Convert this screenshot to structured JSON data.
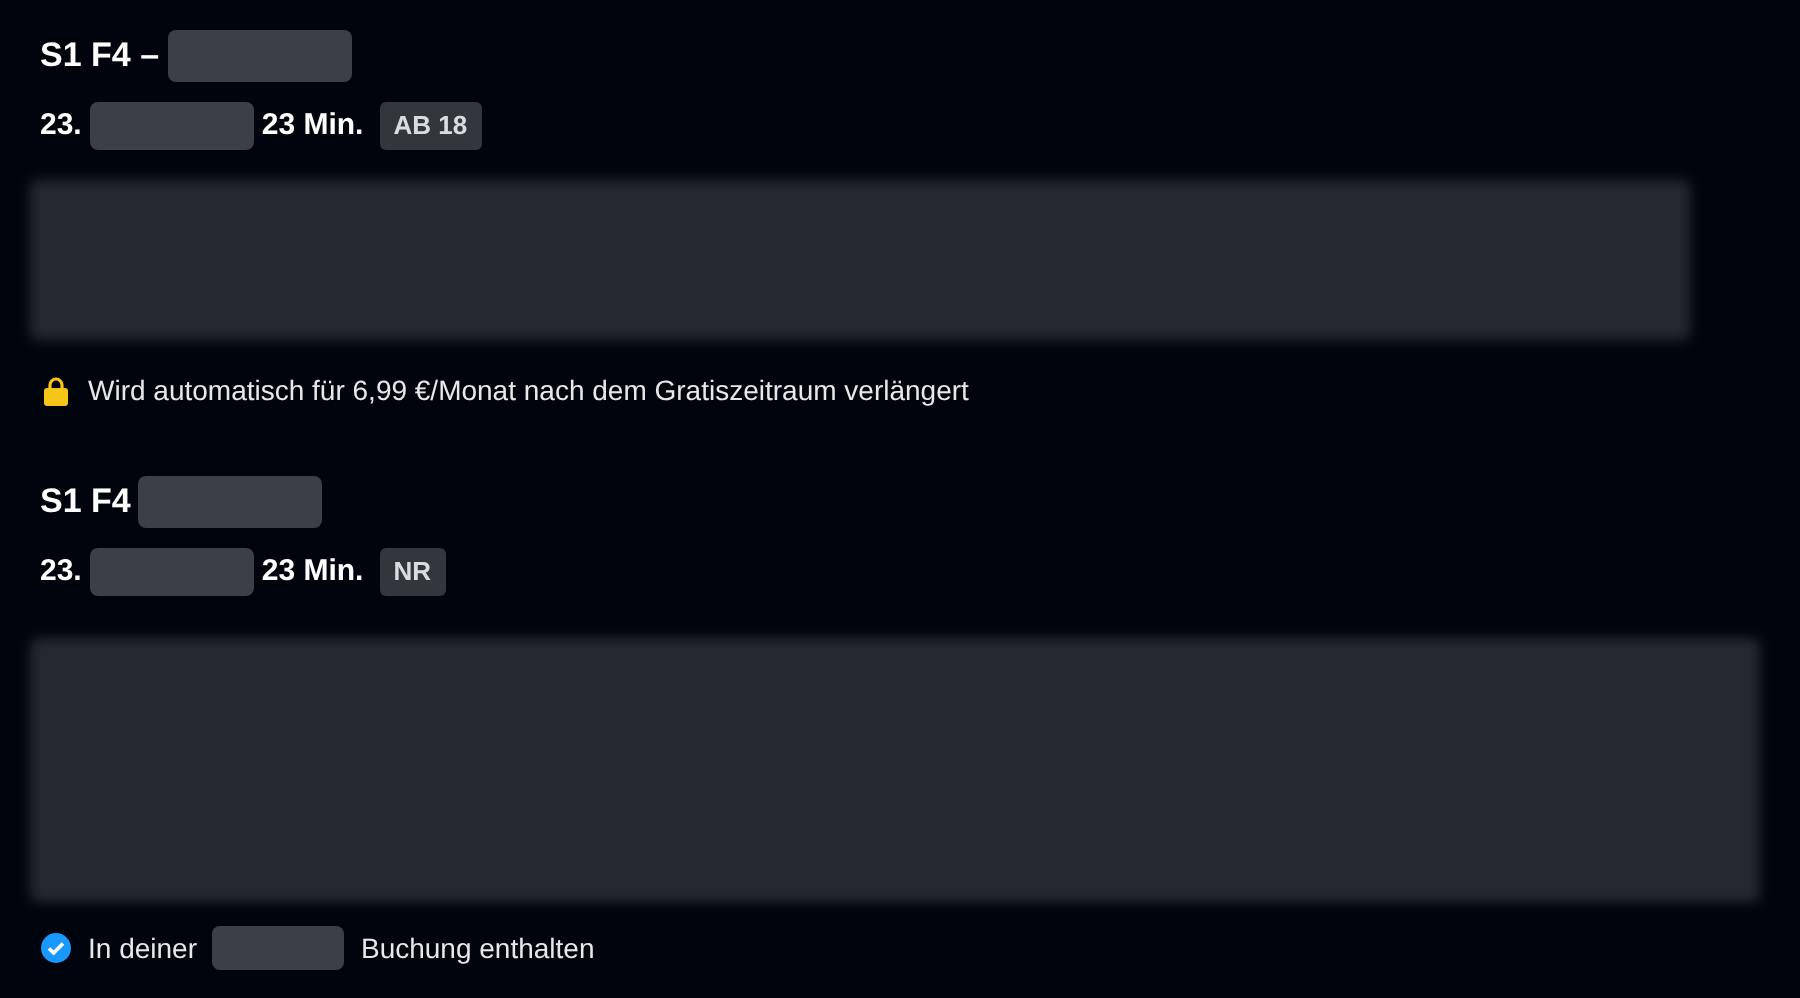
{
  "episodes": [
    {
      "title": "S1 F4 –",
      "date": "23.",
      "duration": "23 Min.",
      "rating": "AB 18",
      "note": {
        "kind": "subscription",
        "texts": [
          "Wird automatisch für 6,99 €/Monat nach dem Gratiszeitraum verlängert"
        ]
      }
    },
    {
      "title": "S1 F4",
      "date": "23.",
      "duration": "23 Min.",
      "rating": "NR",
      "note": {
        "kind": "included",
        "texts": [
          "In deiner",
          "Buchung enthalten"
        ]
      }
    }
  ]
}
